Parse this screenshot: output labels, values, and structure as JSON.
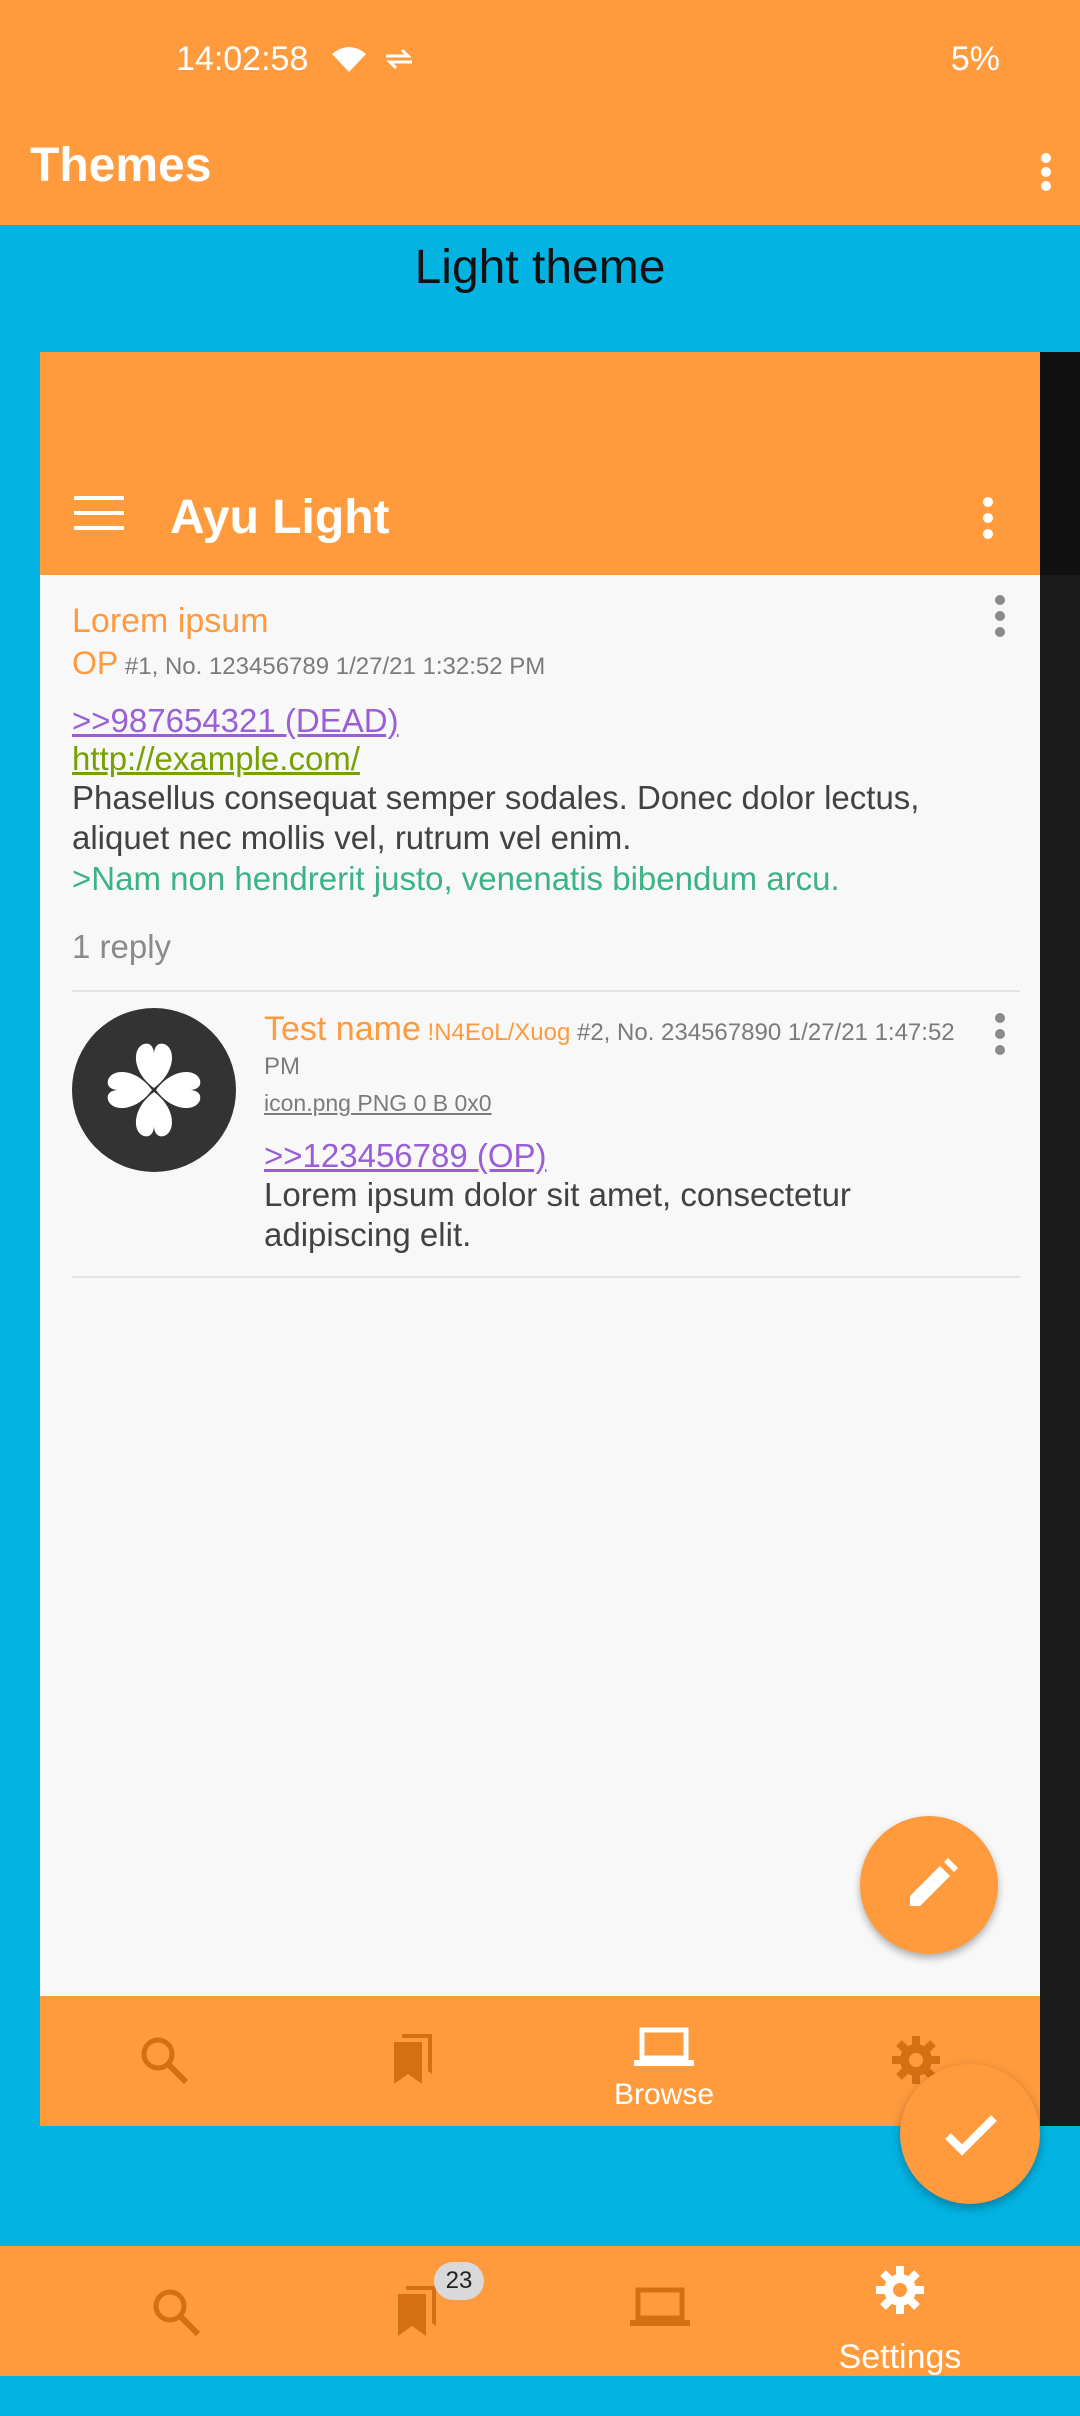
{
  "status_bar": {
    "time": "14:02:58",
    "battery": "5%"
  },
  "app_bar": {
    "title": "Themes"
  },
  "theme_section": {
    "label": "Light theme"
  },
  "preview": {
    "toolbar_title": "Ayu Light",
    "post1": {
      "subject": "Lorem ipsum",
      "op_label": "OP",
      "meta": "#1, No. 123456789 1/27/21 1:32:52 PM",
      "reply_link": ">>987654321 (DEAD)",
      "url": "http://example.com/",
      "body": "Phasellus consequat semper sodales. Donec dolor lectus, aliquet nec mollis vel, rutrum vel enim.",
      "quote": ">Nam non hendrerit justo, venenatis bibendum arcu.",
      "replies": "1 reply"
    },
    "post2": {
      "name": "Test name",
      "tripcode": "!N4EoL/Xuog",
      "meta": "#2, No. 234567890 1/27/21 1:47:52 PM",
      "file_info": "icon.png PNG 0 B 0x0",
      "reply_link": ">>123456789 (OP)",
      "body": "Lorem ipsum dolor sit amet, consectetur adipiscing elit."
    },
    "nav": {
      "active_label": "Browse"
    }
  },
  "bottom_nav": {
    "bookmarks_badge": "23",
    "active_label": "Settings"
  },
  "colors": {
    "primary": "#ff9a3d",
    "background": "#03b4e3",
    "link_reply": "#9a5fd6",
    "link_url": "#78a000",
    "quote": "#3cb286"
  },
  "icons": [
    "wifi-icon",
    "data-transfer-icon",
    "more-vert-icon",
    "menu-icon",
    "edit-icon",
    "search-icon",
    "bookmarks-icon",
    "laptop-icon",
    "gear-icon",
    "check-icon"
  ]
}
